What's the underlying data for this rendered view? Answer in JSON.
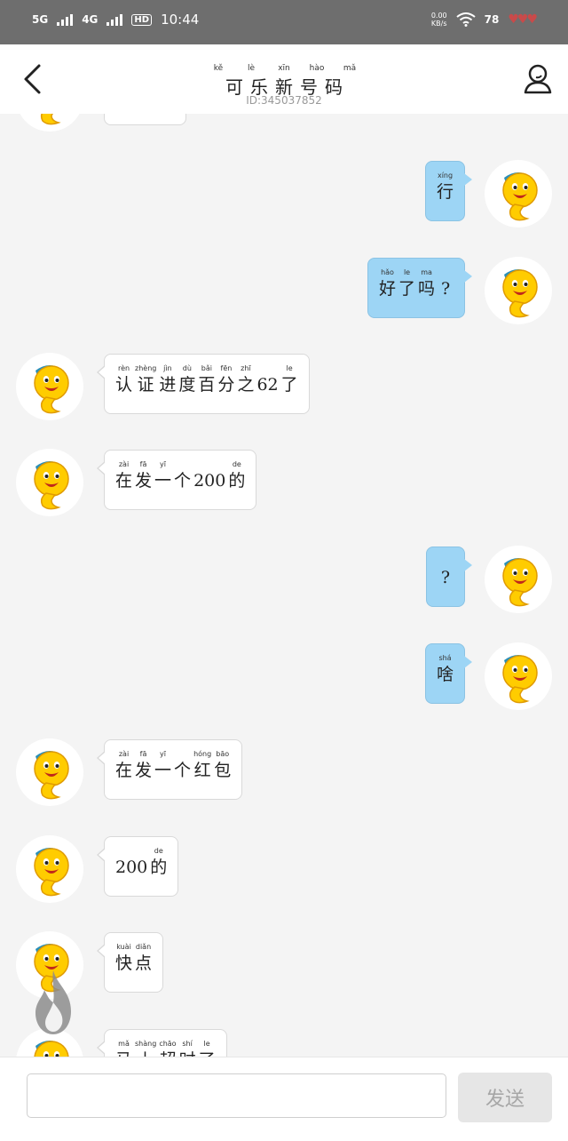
{
  "status_bar": {
    "net1": "5G",
    "net2": "4G",
    "hd": "HD",
    "time": "10:44",
    "speed_value": "0.00",
    "speed_unit": "KB/s",
    "battery": "78"
  },
  "header": {
    "title": "可乐新号码",
    "title_pinyin": [
      "kě",
      "lè",
      "xīn",
      "hào",
      "mǎ"
    ],
    "subtitle": "ID:345037852"
  },
  "messages": [
    {
      "side": "right",
      "chars": [
        {
          "py": "xíng",
          "hz": "行"
        }
      ]
    },
    {
      "side": "right",
      "chars": [
        {
          "py": "hǎo",
          "hz": "好"
        },
        {
          "py": "le",
          "hz": "了"
        },
        {
          "py": "ma",
          "hz": "吗"
        },
        {
          "py": "",
          "hz": "?"
        }
      ]
    },
    {
      "side": "left",
      "chars": [
        {
          "py": "rèn",
          "hz": "认"
        },
        {
          "py": "zhèng",
          "hz": "证"
        },
        {
          "py": "jìn",
          "hz": "进"
        },
        {
          "py": "dù",
          "hz": "度"
        },
        {
          "py": "bǎi",
          "hz": "百"
        },
        {
          "py": "fēn",
          "hz": "分"
        },
        {
          "py": "zhī",
          "hz": "之"
        },
        {
          "py": "",
          "hz": "62"
        },
        {
          "py": "le",
          "hz": "了"
        }
      ]
    },
    {
      "side": "left",
      "chars": [
        {
          "py": "zài",
          "hz": "在"
        },
        {
          "py": "fā",
          "hz": "发"
        },
        {
          "py": "yī",
          "hz": "一"
        },
        {
          "py": "",
          "hz": "个"
        },
        {
          "py": "",
          "hz": "200"
        },
        {
          "py": "de",
          "hz": "的"
        }
      ]
    },
    {
      "side": "right",
      "chars": [
        {
          "py": "",
          "hz": "?"
        }
      ]
    },
    {
      "side": "right",
      "chars": [
        {
          "py": "shá",
          "hz": "啥"
        }
      ]
    },
    {
      "side": "left",
      "chars": [
        {
          "py": "zài",
          "hz": "在"
        },
        {
          "py": "fā",
          "hz": "发"
        },
        {
          "py": "yī",
          "hz": "一"
        },
        {
          "py": "",
          "hz": "个"
        },
        {
          "py": "hóng",
          "hz": "红"
        },
        {
          "py": "bāo",
          "hz": "包"
        }
      ]
    },
    {
      "side": "left",
      "chars": [
        {
          "py": "",
          "hz": "200"
        },
        {
          "py": "de",
          "hz": "的"
        }
      ]
    },
    {
      "side": "left",
      "chars": [
        {
          "py": "kuài",
          "hz": "快"
        },
        {
          "py": "diǎn",
          "hz": "点"
        }
      ]
    },
    {
      "side": "left",
      "chars": [
        {
          "py": "mǎ",
          "hz": "马"
        },
        {
          "py": "shàng",
          "hz": "上"
        },
        {
          "py": "chāo",
          "hz": "超"
        },
        {
          "py": "shí",
          "hz": "时"
        },
        {
          "py": "le",
          "hz": "了"
        }
      ]
    }
  ],
  "input": {
    "value": "",
    "placeholder": "",
    "send_label": "发送"
  },
  "colors": {
    "status_bar": "#6e6e6e",
    "bubble_right": "#9dd5f5",
    "bubble_left": "#ffffff",
    "background": "#f4f4f4"
  },
  "icons": {
    "back": "chevron-left-icon",
    "profile": "person-icon",
    "avatar": "cartoon-sun-avatar-icon",
    "fire": "fire-icon"
  }
}
